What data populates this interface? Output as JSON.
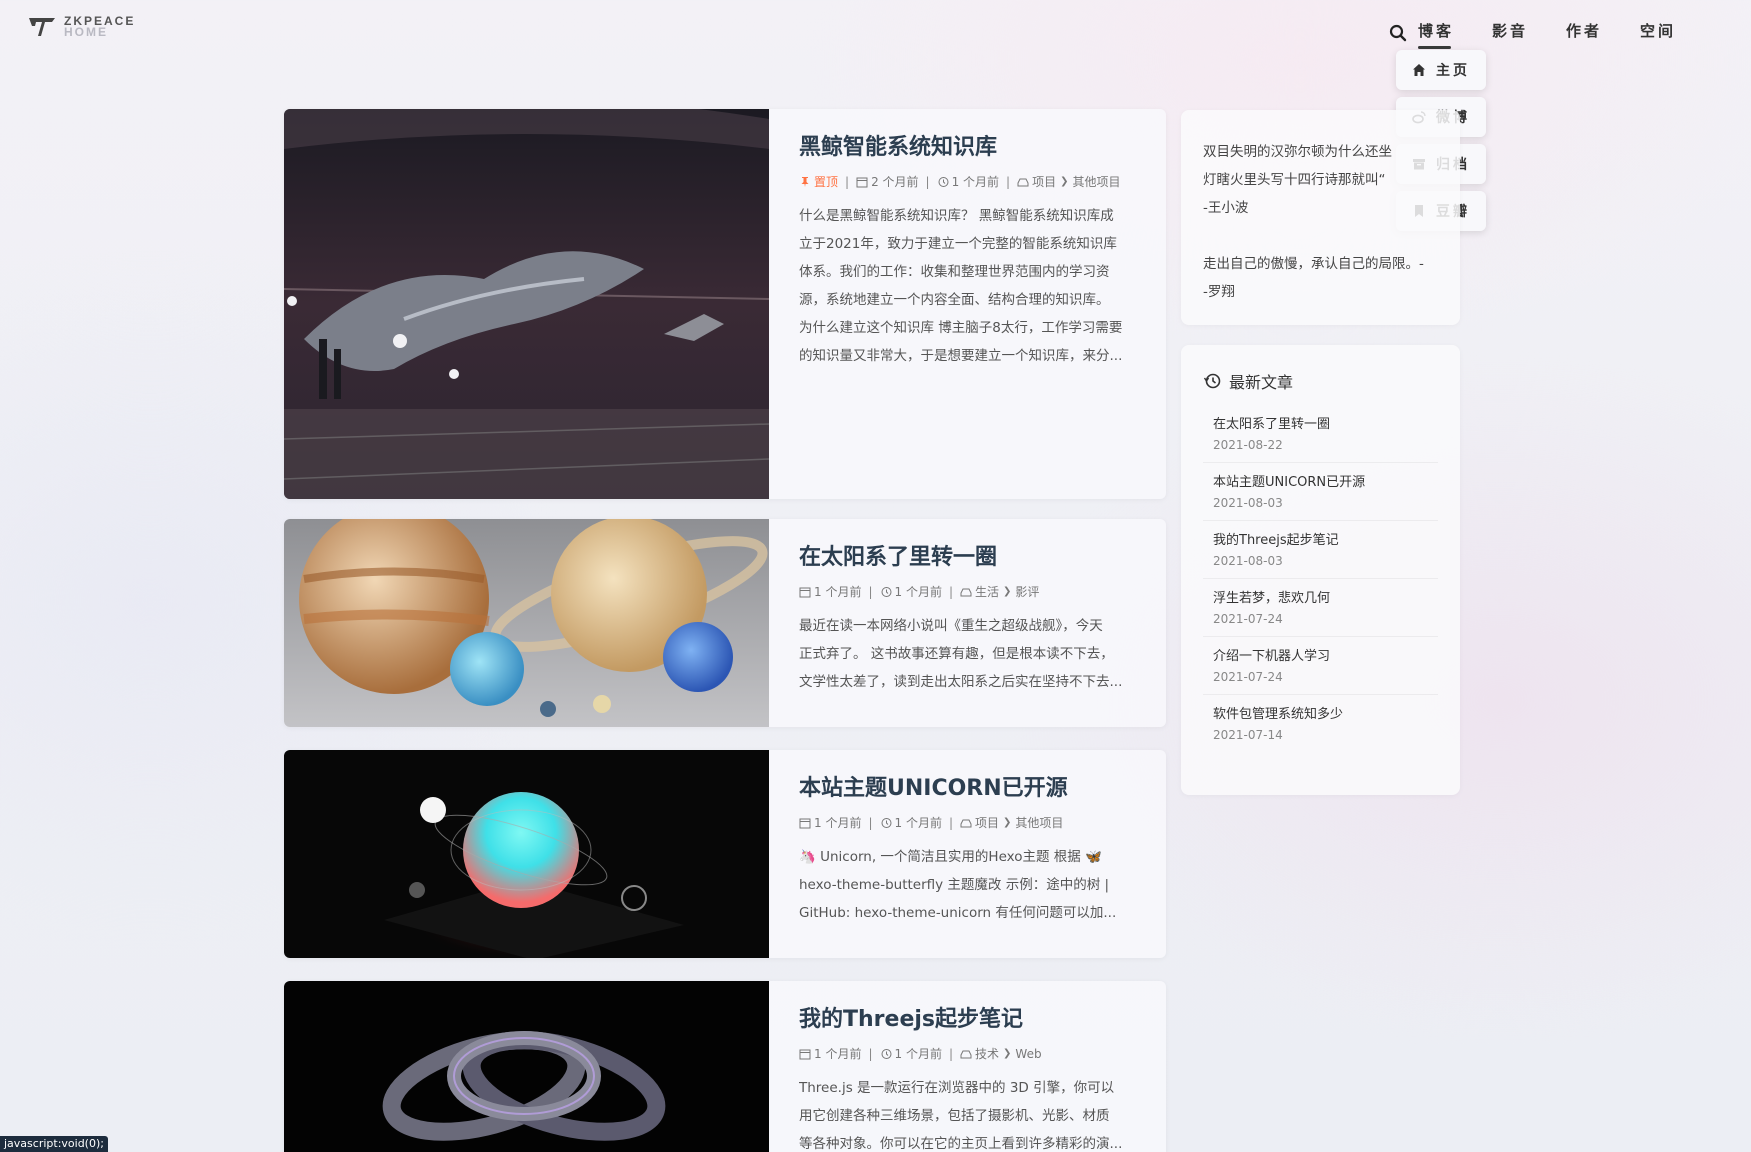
{
  "header": {
    "logo_line1": "ZKPEACE",
    "logo_line2": "HOME",
    "nav": [
      "博客",
      "影音",
      "作者",
      "空间"
    ],
    "dropdown": [
      {
        "label": "主页",
        "icon": "home-icon"
      },
      {
        "label": "微博",
        "icon": "weibo-icon"
      },
      {
        "label": "归档",
        "icon": "archive-icon"
      },
      {
        "label": "豆瓣",
        "icon": "bookmark-icon"
      }
    ]
  },
  "posts": [
    {
      "title": "黑鲸智能系统知识库",
      "pinned": "置顶",
      "created": "2 个月前",
      "updated": "1 个月前",
      "category": "项目",
      "subcategory": "其他项目",
      "excerpt": [
        "什么是黑鲸智能系统知识库？ 黑鲸智能系统知识库成",
        "立于2021年，致力于建立一个完整的智能系统知识库",
        "体系。我们的工作：收集和整理世界范围内的学习资",
        "源，系统地建立一个内容全面、结构合理的知识库。",
        "为什么建立这个知识库 博主脑子8太行，工作学习需要",
        "的知识量又非常大，于是想要建立一个知识库，来分..."
      ]
    },
    {
      "title": "在太阳系了里转一圈",
      "created": "1 个月前",
      "updated": "1 个月前",
      "category": "生活",
      "subcategory": "影评",
      "excerpt": [
        "最近在读一本网络小说叫《重生之超级战舰》，今天",
        "正式弃了。 这书故事还算有趣，但是根本读不下去，",
        "文学性太差了，读到走出太阳系之后实在坚持不下去..."
      ]
    },
    {
      "title": "本站主题UNICORN已开源",
      "created": "1 个月前",
      "updated": "1 个月前",
      "category": "项目",
      "subcategory": "其他项目",
      "excerpt": [
        "🦄 Unicorn, 一个简洁且实用的Hexo主题 根据 🦋",
        "hexo-theme-butterfly 主题魔改 示例：途中的树 |",
        "GitHub: hexo-theme-unicorn 有任何问题可以加..."
      ]
    },
    {
      "title": "我的Threejs起步笔记",
      "created": "1 个月前",
      "updated": "1 个月前",
      "category": "技术",
      "subcategory": "Web",
      "excerpt": [
        "Three.js 是一款运行在浏览器中的 3D 引擎，你可以",
        "用它创建各种三维场景，包括了摄影机、光影、材质",
        "等各种对象。你可以在它的主页上看到许多精彩的演..."
      ]
    }
  ],
  "sidebar": {
    "quote_lines": [
      "双目失明的汉弥尔顿为什么还坐",
      "灯瞎火里头写十四行诗那就叫“",
      "-王小波",
      "",
      "走出自己的傲慢，承认自己的局限。-",
      "-罗翔"
    ],
    "recent_title": "最新文章",
    "recent": [
      {
        "title": "在太阳系了里转一圈",
        "date": "2021-08-22"
      },
      {
        "title": "本站主题UNICORN已开源",
        "date": "2021-08-03"
      },
      {
        "title": "我的Threejs起步笔记",
        "date": "2021-08-03"
      },
      {
        "title": "浮生若梦，悲欢几何",
        "date": "2021-07-24"
      },
      {
        "title": "介绍一下机器人学习",
        "date": "2021-07-24"
      },
      {
        "title": "软件包管理系统知多少",
        "date": "2021-07-14"
      }
    ]
  },
  "status_bar": "javascript:void(0);"
}
